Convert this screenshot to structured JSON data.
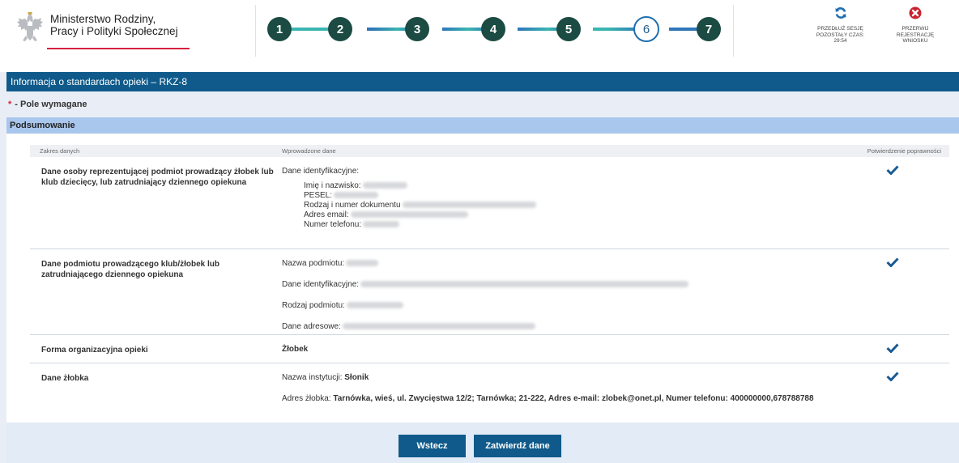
{
  "header": {
    "ministry_line1": "Ministerstwo Rodziny,",
    "ministry_line2": "Pracy i Polityki Społecznej",
    "steps": [
      "1",
      "2",
      "3",
      "4",
      "5",
      "6",
      "7"
    ],
    "current_step": "6",
    "extend_session_line1": "PRZEDŁUŻ SESJĘ",
    "extend_session_line2": "POZOSTAŁY CZAS: 29:54",
    "abort_line1": "PRZERWIJ",
    "abort_line2": "REJESTRACJĘ",
    "abort_line3": "WNIOSKU"
  },
  "title": "Informacja o standardach opieki – RKZ-8",
  "required_star": "*",
  "required_label": "- Pole wymagane",
  "section_title": "Podsumowanie",
  "table": {
    "headers": [
      "Zakres danych",
      "Wprowadzone dane",
      "Potwierdzenie poprawności"
    ],
    "rows": [
      {
        "scope": "Dane osoby reprezentującej podmiot prowadzący żłobek lub klub dziecięcy, lub zatrudniający dziennego opiekuna",
        "title": "Dane identyfikacyjne:",
        "fields": [
          "Imię i nazwisko:",
          "PESEL:",
          "Rodzaj i numer dokumentu",
          "Adres email:",
          "Numer telefonu:"
        ]
      },
      {
        "scope": "Dane podmiotu prowadzącego klub/żłobek lub zatrudniającego dziennego opiekuna",
        "fields": [
          "Nazwa podmiotu:",
          "Dane identyfikacyjne:",
          "Rodzaj podmiotu:",
          "Dane adresowe:"
        ]
      },
      {
        "scope": "Forma organizacyjna opieki",
        "value": "Żłobek"
      },
      {
        "scope": "Dane żłobka",
        "name_label": "Nazwa instytucji:",
        "name_value": "Słonik",
        "address_label": "Adres żłobka:",
        "address_value": "Tarnówka, wieś, ul. Zwycięstwa 12/2; Tarnówka; 21-222, Adres e-mail: zlobek@onet.pl, Numer telefonu: 400000000,678788788"
      }
    ]
  },
  "buttons": {
    "back": "Wstecz",
    "confirm": "Zatwierdź dane"
  },
  "colors": {
    "primary": "#0f5a8a",
    "section": "#a9c6ec",
    "check": "#1a5a94",
    "step_fill": "#1b4b42",
    "accent_red": "#d4213d"
  }
}
